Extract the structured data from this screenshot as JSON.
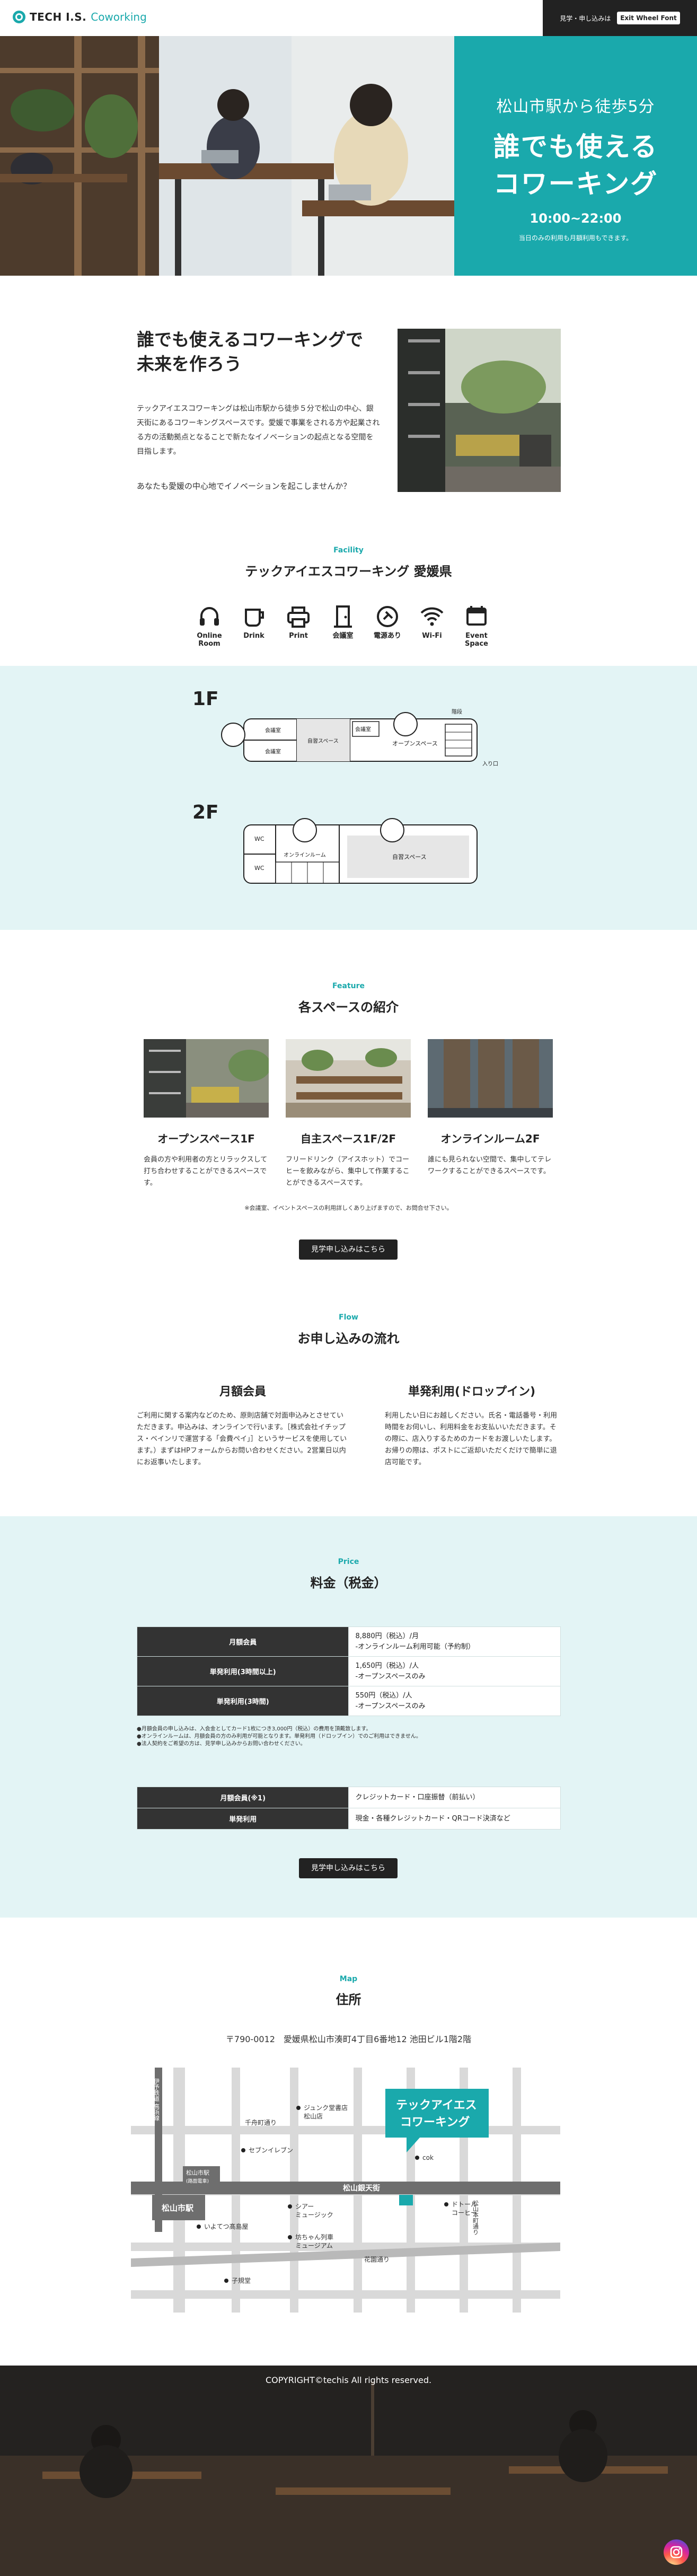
{
  "header": {
    "brand_main": "TECH I.S.",
    "brand_sub": "Coworking",
    "cta_text": "見学・申し込みは",
    "cta_button": "Exit Wheel Font"
  },
  "hero": {
    "subtitle": "松山市駅から徒歩5分",
    "title_line1": "誰でも使える",
    "title_line2": "コワーキング",
    "hours": "10:00~22:00",
    "note": "当日のみの利用も月額利用もできます。"
  },
  "about": {
    "title_line1": "誰でも使えるコワーキングで",
    "title_line2": "未来を作ろう",
    "body": "テックアイエスコワーキングは松山市駅から徒歩５分で松山の中心、銀天街にあるコワーキングスペースです。愛媛で事業をされる方や起業される方の活動拠点となることで新たなイノベーションの起点となる空間を目指します。",
    "question": "あなたも愛媛の中心地でイノベーションを起こしませんか？"
  },
  "facility": {
    "label": "Facility",
    "title": "テックアイエスコワーキング 愛媛県",
    "items": [
      {
        "icon": "headphones-icon",
        "line1": "Online",
        "line2": "Room"
      },
      {
        "icon": "cup-icon",
        "line1": "Drink",
        "line2": ""
      },
      {
        "icon": "printer-icon",
        "line1": "Print",
        "line2": ""
      },
      {
        "icon": "door-icon",
        "line1": "会議室",
        "line2": ""
      },
      {
        "icon": "plug-icon",
        "line1": "電源あり",
        "line2": ""
      },
      {
        "icon": "wifi-icon",
        "line1": "Wi-Fi",
        "line2": ""
      },
      {
        "icon": "event-icon",
        "line1": "Event",
        "line2": "Space"
      }
    ]
  },
  "floor": {
    "f1": {
      "tag": "1F",
      "meeting1": "会議室",
      "meeting2": "会議室",
      "meeting3": "会議室",
      "free_space": "自習スペース",
      "open_space": "オープンスペース",
      "stairs": "階段",
      "entrance": "入り口"
    },
    "f2": {
      "tag": "2F",
      "wc1": "WC",
      "wc2": "WC",
      "online_room": "オンラインルーム",
      "free_space": "自習スペース"
    }
  },
  "feature": {
    "label": "Feature",
    "title": "各スペースの紹介",
    "items": [
      {
        "title": "オープンスペース1F",
        "desc": "会員の方や利用者の方とリラックスして打ち合わせすることができるスペースです。"
      },
      {
        "title": "自主スペース1F/2F",
        "desc": "フリードリンク（アイスホット）でコーヒーを飲みながら、集中して作業することができるスペースです。"
      },
      {
        "title": "オンラインルーム2F",
        "desc": "誰にも見られない空間で、集中してテレワークすることができるスペースです。"
      }
    ],
    "note": "※会議室、イベントスペースの利用詳しくあり上げますので、お問合せ下さい。",
    "button": "見学申し込みはこちら"
  },
  "flow": {
    "label": "Flow",
    "title": "お申し込みの流れ",
    "monthly_title": "月額会員",
    "monthly_body": "ご利用に関する案内などのため、原則店舗で対面申込みとさせていただきます。申込みは、オンラインで行います。［株式会社イチップス・ベインリで運営する「会費ペイ」］というサービスを使用しています。）まずはHPフォームからお問い合わせください。2営業日以内にお返事いたします。",
    "dropin_title": "単発利用(ドロップイン)",
    "dropin_body": "利用したい日にお越しください。氏名・電話番号・利用時間をお伺いし、利用料金をお支払いいただきます。その際に、店入りするためのカードをお渡しいたします。お帰りの際は、ポストにご返却いただくだけで簡単に退店可能です。"
  },
  "price": {
    "label": "Price",
    "title": "料金（税金）",
    "rows": [
      {
        "key": "月額会員",
        "v1": "8,880円（税込）/月",
        "v2": "-オンラインルーム利用可能（予約制）"
      },
      {
        "key": "単発利用(3時間以上)",
        "v1": "1,650円（税込）/人",
        "v2": "-オープンスペースのみ"
      },
      {
        "key": "単発利用(3時間)",
        "v1": "550円（税込）/人",
        "v2": "-オープンスペースのみ"
      }
    ],
    "notes": [
      "●月額会員の申し込みは、入会金としてカード1枚につき3,000円（税込）の費用を頂戴致します。",
      "●オンラインルームは、月額会員の方のみ利用が可能となります。単発利用（ドロップイン）でのご利用はできません。",
      "●法人契約をご希望の方は、見学申し込みからお問い合わせください。"
    ],
    "pay_rows": [
      {
        "key": "月額会員(※1)",
        "val": "クレジットカード・口座振替（前払い）"
      },
      {
        "key": "単発利用",
        "val": "現金・各種クレジットカード・QRコード決済など"
      }
    ],
    "button": "見学申し込みはこちら"
  },
  "map": {
    "label": "Map",
    "title": "住所",
    "address": "〒790-0012　愛媛県松山市湊町4丁目6番地12 池田ビル1階2階",
    "pin_line1": "テックアイエス",
    "pin_line2": "コワーキング",
    "station": "松山市駅",
    "station_nearby": "松山市駅",
    "station_nearby_sub": "(路面電車)",
    "street_main": "松山銀天街",
    "street_mid": "千舟町通り",
    "street_low": "花園通り",
    "rail": "伊予鉄道 高浜線",
    "street_right": "松山本町通り",
    "poi": [
      "ジュンク堂書店",
      "松山店",
      "セブンイレブン",
      "cok",
      "シアー",
      "ミュージック",
      "ドトール",
      "コーヒー",
      "いよてつ髙島屋",
      "坊ちゃん列車",
      "ミュージアム",
      "子規堂"
    ]
  },
  "footer": {
    "copyright": "COPYRIGHT©techis All rights reserved."
  }
}
